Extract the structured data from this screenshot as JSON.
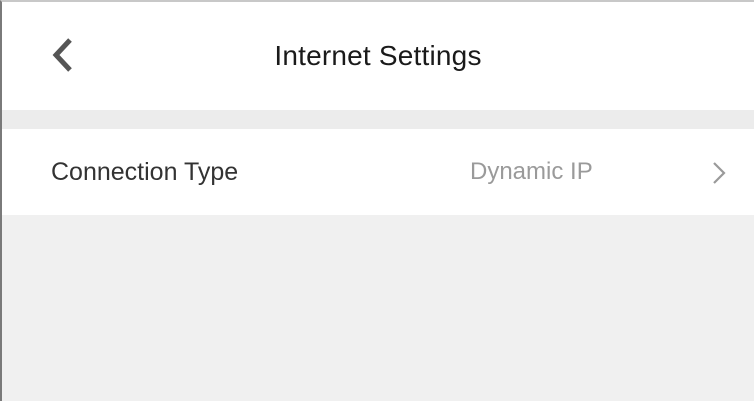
{
  "header": {
    "title": "Internet Settings",
    "back_icon": "chevron-left-icon"
  },
  "settings": {
    "rows": [
      {
        "label": "Connection Type",
        "value": "Dynamic IP",
        "icon": "chevron-right-icon"
      }
    ]
  },
  "colors": {
    "background": "#f0f0f0",
    "header_background": "#ffffff",
    "title_text": "#1a1a1a",
    "label_text": "#333333",
    "value_text": "#9a9a9a",
    "chevron": "#9a9a9a"
  }
}
